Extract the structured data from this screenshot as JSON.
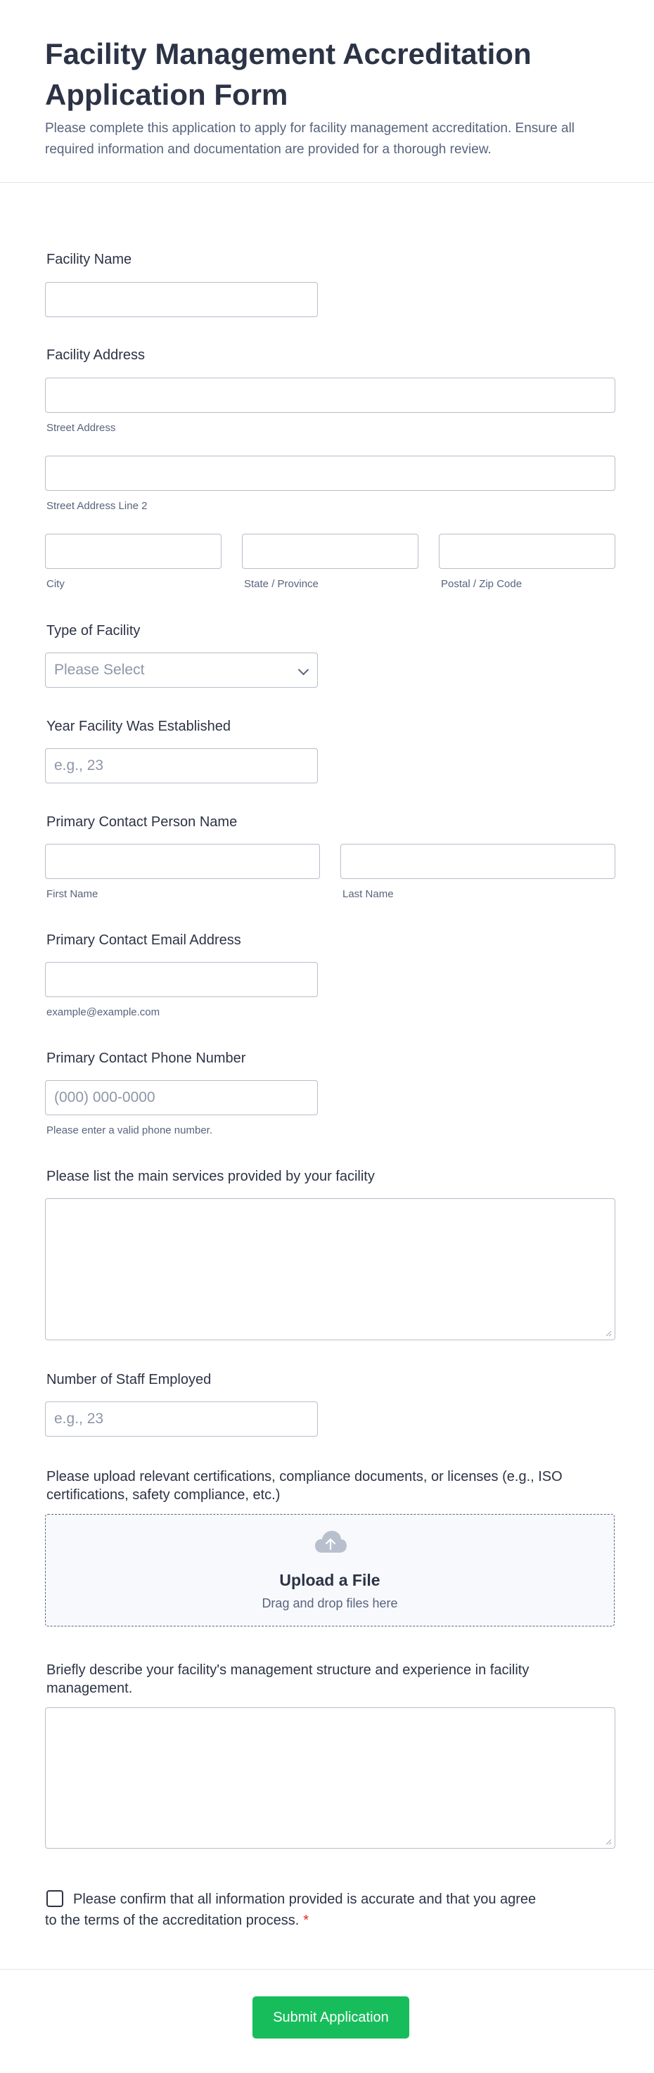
{
  "header": {
    "title": "Facility Management Accreditation Application Form",
    "subtitle": "Please complete this application to apply for facility management accreditation. Ensure all required information and documentation are provided for a thorough review."
  },
  "fields": {
    "facility_name": {
      "label": "Facility Name",
      "value": ""
    },
    "facility_address": {
      "label": "Facility Address",
      "street": {
        "value": "",
        "sublabel": "Street Address"
      },
      "street2": {
        "value": "",
        "sublabel": "Street Address Line 2"
      },
      "city": {
        "value": "",
        "sublabel": "City"
      },
      "state": {
        "value": "",
        "sublabel": "State / Province"
      },
      "postal": {
        "value": "",
        "sublabel": "Postal / Zip Code"
      }
    },
    "facility_type": {
      "label": "Type of Facility",
      "selected": "Please Select"
    },
    "year_established": {
      "label": "Year Facility Was Established",
      "placeholder": "e.g., 23"
    },
    "contact_name": {
      "label": "Primary Contact Person Name",
      "first": {
        "value": "",
        "sublabel": "First Name"
      },
      "last": {
        "value": "",
        "sublabel": "Last Name"
      }
    },
    "contact_email": {
      "label": "Primary Contact Email Address",
      "value": "",
      "sublabel": "example@example.com"
    },
    "contact_phone": {
      "label": "Primary Contact Phone Number",
      "placeholder": "(000) 000-0000",
      "sublabel": "Please enter a valid phone number."
    },
    "services": {
      "label": "Please list the main services provided by your facility",
      "value": ""
    },
    "staff_count": {
      "label": "Number of Staff Employed",
      "placeholder": "e.g., 23"
    },
    "documents_upload": {
      "label": "Please upload relevant certifications, compliance documents, or licenses (e.g., ISO certifications, safety compliance, etc.)",
      "title": "Upload a File",
      "subtitle": "Drag and drop files here",
      "icon": "cloud-upload-icon"
    },
    "management_structure": {
      "label": "Briefly describe your facility's management structure and experience in facility management.",
      "value": ""
    },
    "confirmation": {
      "text": "Please confirm that all information provided is accurate and that you agree to the terms of the accreditation process.",
      "required_mark": "*",
      "checked": false
    }
  },
  "submit": {
    "label": "Submit Application"
  },
  "colors": {
    "accent": "#18bd5b",
    "required": "#e5261b",
    "text": "#2c3345",
    "muted": "#57647e",
    "border": "#b8bdc9"
  }
}
